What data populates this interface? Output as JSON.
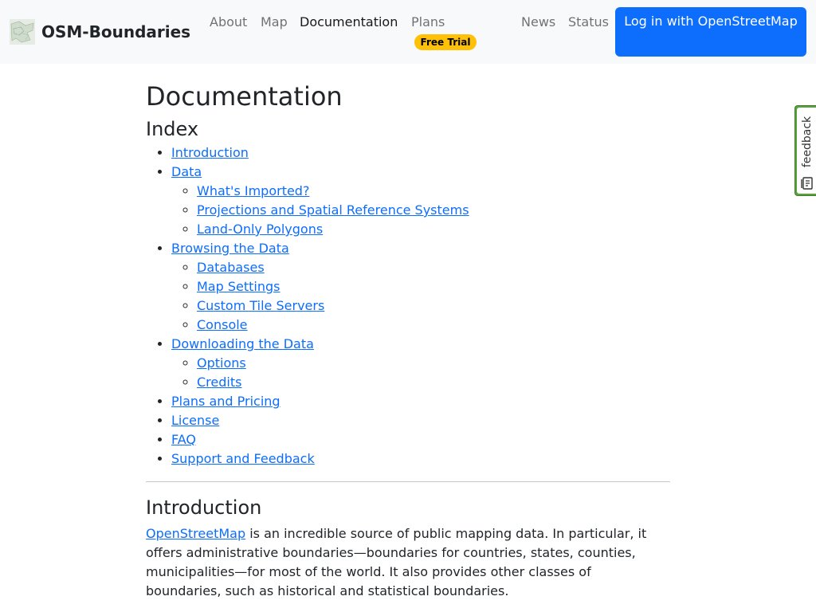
{
  "navbar": {
    "brand_name": "OSM-Boundaries",
    "links": [
      {
        "label": "About"
      },
      {
        "label": "Map"
      },
      {
        "label": "Documentation"
      },
      {
        "label": "Plans"
      },
      {
        "label": "News"
      },
      {
        "label": "Status"
      }
    ],
    "active": "Documentation",
    "plans_badge": "Free Trial",
    "login_label": "Log in with OpenStreetMap"
  },
  "main": {
    "title": "Documentation",
    "index_heading": "Index",
    "index": [
      {
        "label": "Introduction"
      },
      {
        "label": "Data",
        "children": [
          "What's Imported?",
          "Projections and Spatial Reference Systems",
          "Land-Only Polygons"
        ]
      },
      {
        "label": "Browsing the Data",
        "children": [
          "Databases",
          "Map Settings",
          "Custom Tile Servers",
          "Console"
        ]
      },
      {
        "label": "Downloading the Data",
        "children": [
          "Options",
          "Credits"
        ]
      },
      {
        "label": "Plans and Pricing"
      },
      {
        "label": "License"
      },
      {
        "label": "FAQ"
      },
      {
        "label": "Support and Feedback"
      }
    ],
    "intro_heading": "Introduction",
    "intro_link": "OpenStreetMap",
    "intro_text": " is an incredible source of public mapping data. In particular, it offers administrative boundaries—boundaries for countries, states, counties, municipalities—for most of the world. It also provides other classes of boundaries, such as historical and statistical boundaries."
  },
  "feedback": {
    "label": "feedback",
    "icon": "feedback-form-icon"
  },
  "colors": {
    "accent": "#0d6efd",
    "badge": "#ffc107",
    "feedback": "#58a33f",
    "navbar_bg": "#f8f9fa"
  }
}
